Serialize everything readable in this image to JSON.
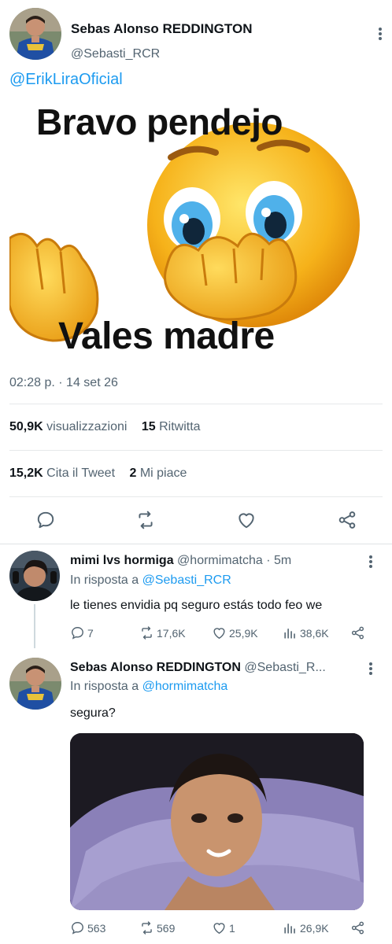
{
  "main_tweet": {
    "author_name": "Sebas Alonso REDDINGTON",
    "author_handle": "@Sebasti_RCR",
    "mention": "@ErikLiraOficial",
    "meme_top_text": "Bravo pendejo",
    "meme_bottom_text": "Vales madre",
    "timestamp": "02:28 p. · 14 set 26",
    "stats": {
      "views_count": "50,9K",
      "views_label": "visualizzazioni",
      "retweets_count": "15",
      "retweets_label": "Ritwitta",
      "quotes_count": "15,2K",
      "quotes_label": "Cita il Tweet",
      "likes_count": "2",
      "likes_label": "Mi piace"
    },
    "actions": [
      "reply-icon",
      "retweet-icon",
      "heart-icon",
      "share-icon"
    ]
  },
  "replies": [
    {
      "author_name": "mimi lvs hormiga",
      "author_handle": "@hormimatcha",
      "time_meta": "· 5m",
      "reply_prefix": "In risposta a",
      "reply_to": "@Sebasti_RCR",
      "text": "le tienes envidia pq seguro estás todo feo we",
      "counts": {
        "replies": "7",
        "retweets": "17,6K",
        "likes": "25,9K",
        "views": "38,6K"
      }
    },
    {
      "author_name": "Sebas Alonso REDDINGTON",
      "author_handle": "@Sebasti_R...",
      "time_meta": "",
      "reply_prefix": "In risposta a",
      "reply_to": "@hormimatcha",
      "text": "segura?",
      "counts": {
        "replies": "563",
        "retweets": "569",
        "likes": "1",
        "views": "26,9K"
      }
    }
  ],
  "colors": {
    "link": "#1d9bf0",
    "secondary_text": "#536471",
    "primary_text": "#0f1419",
    "divider": "#e6e9ea"
  }
}
